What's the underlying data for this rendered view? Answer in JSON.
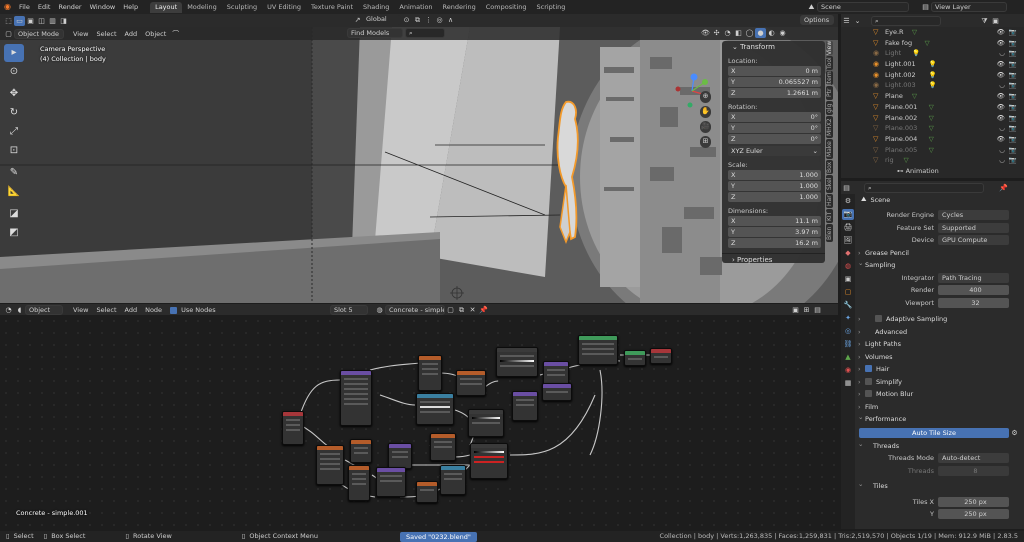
{
  "menubar": {
    "menus": [
      "File",
      "Edit",
      "Render",
      "Window",
      "Help"
    ],
    "workspaces": [
      "Layout",
      "Modeling",
      "Sculpting",
      "UV Editing",
      "Texture Paint",
      "Shading",
      "Animation",
      "Rendering",
      "Compositing",
      "Scripting"
    ],
    "scene": "Scene",
    "view_layer": "View Layer"
  },
  "viewport_header": {
    "mode": "Object Mode",
    "menus": [
      "View",
      "Select",
      "Add",
      "Object"
    ],
    "orientation": "Global",
    "options": "Options",
    "find_models": "Find Models"
  },
  "viewport": {
    "view_name": "Camera Perspective",
    "collection_info": "(4) Collection | body"
  },
  "npanel": {
    "transform_title": "Transform",
    "location_label": "Location:",
    "location": [
      {
        "axis": "X",
        "value": "0 m"
      },
      {
        "axis": "Y",
        "value": "0.065527 m"
      },
      {
        "axis": "Z",
        "value": "1.2661 m"
      }
    ],
    "rotation_label": "Rotation:",
    "rotation": [
      {
        "axis": "X",
        "value": "0°"
      },
      {
        "axis": "Y",
        "value": "0°"
      },
      {
        "axis": "Z",
        "value": "0°"
      }
    ],
    "rotation_mode": "XYZ Euler",
    "scale_label": "Scale:",
    "scale": [
      {
        "axis": "X",
        "value": "1.000"
      },
      {
        "axis": "Y",
        "value": "1.000"
      },
      {
        "axis": "Z",
        "value": "1.000"
      }
    ],
    "dimensions_label": "Dimensions:",
    "dimensions": [
      {
        "axis": "X",
        "value": "11.1 m"
      },
      {
        "axis": "Y",
        "value": "3.97 m"
      },
      {
        "axis": "Z",
        "value": "16.2 m"
      }
    ],
    "properties_title": "Properties"
  },
  "side_tabs": [
    "View",
    "Tool",
    "Item",
    "Ptr",
    "glg",
    "MHX2",
    "Make",
    "Box",
    "Skel",
    "Har",
    "KIT",
    "Blen"
  ],
  "node_header": {
    "type": "Object",
    "menus": [
      "View",
      "Select",
      "Add",
      "Node"
    ],
    "use_nodes": "Use Nodes",
    "slot": "Slot 5",
    "material": "Concrete - simple.0..."
  },
  "node_editor": {
    "material_label": "Concrete - simple.001"
  },
  "outliner": {
    "items": [
      {
        "name": "Eye.R",
        "dim": false
      },
      {
        "name": "Fake fog",
        "dim": false
      },
      {
        "name": "Light",
        "dim": true
      },
      {
        "name": "Light.001",
        "dim": false
      },
      {
        "name": "Light.002",
        "dim": false
      },
      {
        "name": "Light.003",
        "dim": true
      },
      {
        "name": "Plane",
        "dim": false
      },
      {
        "name": "Plane.001",
        "dim": false
      },
      {
        "name": "Plane.002",
        "dim": false
      },
      {
        "name": "Plane.003",
        "dim": true
      },
      {
        "name": "Plane.004",
        "dim": false
      },
      {
        "name": "Plane.005",
        "dim": true
      },
      {
        "name": "rig",
        "dim": true
      }
    ],
    "sub_item": "Animation"
  },
  "properties": {
    "scene_name": "Scene",
    "render_engine_label": "Render Engine",
    "render_engine": "Cycles",
    "feature_set_label": "Feature Set",
    "feature_set": "Supported",
    "device_label": "Device",
    "device": "GPU Compute",
    "grease_pencil": "Grease Pencil",
    "sampling": "Sampling",
    "integrator_label": "Integrator",
    "integrator": "Path Tracing",
    "render_label": "Render",
    "render_samples": "400",
    "viewport_label": "Viewport",
    "viewport_samples": "32",
    "adaptive_sampling": "Adaptive Sampling",
    "advanced": "Advanced",
    "light_paths": "Light Paths",
    "volumes": "Volumes",
    "hair": "Hair",
    "simplify": "Simplify",
    "motion_blur": "Motion Blur",
    "film": "Film",
    "performance": "Performance",
    "auto_tile_size": "Auto Tile Size",
    "threads": "Threads",
    "threads_mode_label": "Threads Mode",
    "threads_mode": "Auto-detect",
    "threads_count_label": "Threads",
    "threads_count": "8",
    "tiles": "Tiles",
    "tiles_x_label": "Tiles X",
    "tiles_x": "250 px",
    "tiles_y_label": "Y",
    "tiles_y": "250 px"
  },
  "statusbar": {
    "select": "Select",
    "box_select": "Box Select",
    "rotate_view": "Rotate View",
    "context_menu": "Object Context Menu",
    "saved": "Saved \"0232.blend\"",
    "stats": "Collection | body | Verts:1,263,835 | Faces:1,259,831 | Tris:2,519,570 | Objects 1/19 | Mem: 912.9 MiB | 2.83.5"
  },
  "colors": {
    "accent": "#4772b3",
    "selection_outline": "#f39a2b",
    "object_icon": "#e8902a",
    "light_icon": "#5ea64c"
  }
}
